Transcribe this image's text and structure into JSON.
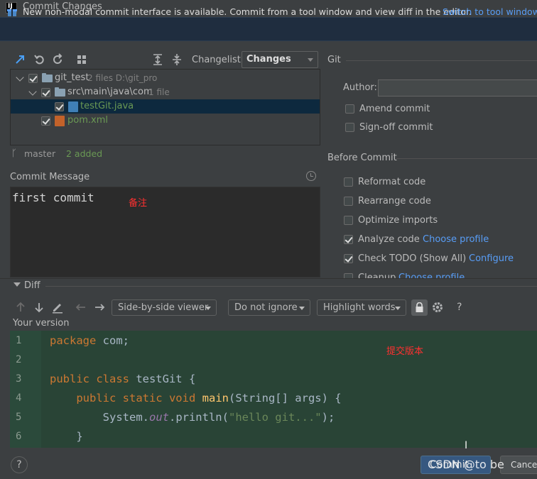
{
  "window": {
    "title": "Commit Changes"
  },
  "banner": {
    "text": "New non-modal commit interface is available. Commit from a tool window and view diff in the editor.",
    "link": "Switch to tool window"
  },
  "toolbar": {
    "changelist_label": "Changelist:",
    "changelist_value": "Changes"
  },
  "tree": {
    "root": {
      "name": "git_test",
      "meta": "2 files  D:\\git_pro"
    },
    "folder": {
      "name": "src\\main\\java\\com",
      "meta": "1 file"
    },
    "file1": {
      "name": "testGit.java"
    },
    "file2": {
      "name": "pom.xml"
    }
  },
  "branch": {
    "name": "master",
    "status": "2 added"
  },
  "commit_message": {
    "label": "Commit Message",
    "text": "first commit",
    "annotation": "备注"
  },
  "git_panel": {
    "title": "Git",
    "author_label": "Author:",
    "author_value": "",
    "amend": "Amend commit",
    "signoff": "Sign-off commit"
  },
  "before_commit": {
    "title": "Before Commit",
    "options": [
      {
        "label": "Reformat code",
        "checked": false,
        "link": ""
      },
      {
        "label": "Rearrange code",
        "checked": false,
        "link": ""
      },
      {
        "label": "Optimize imports",
        "checked": false,
        "link": ""
      },
      {
        "label": "Analyze code",
        "checked": true,
        "link": "Choose profile"
      },
      {
        "label": "Check TODO (Show All)",
        "checked": true,
        "link": "Configure"
      },
      {
        "label": "Cleanup",
        "checked": false,
        "link": "Choose profile"
      }
    ]
  },
  "diff": {
    "label": "Diff",
    "viewer": "Side-by-side viewer",
    "ignore": "Do not ignore",
    "highlight": "Highlight words",
    "help": "?",
    "your_version": "Your version",
    "annotation": "提交版本",
    "lines": [
      "1",
      "2",
      "3",
      "4",
      "5",
      "6"
    ]
  },
  "footer": {
    "help": "?",
    "commit": "Commit",
    "cancel": "Cancel",
    "watermark": "CSDN @to be"
  }
}
